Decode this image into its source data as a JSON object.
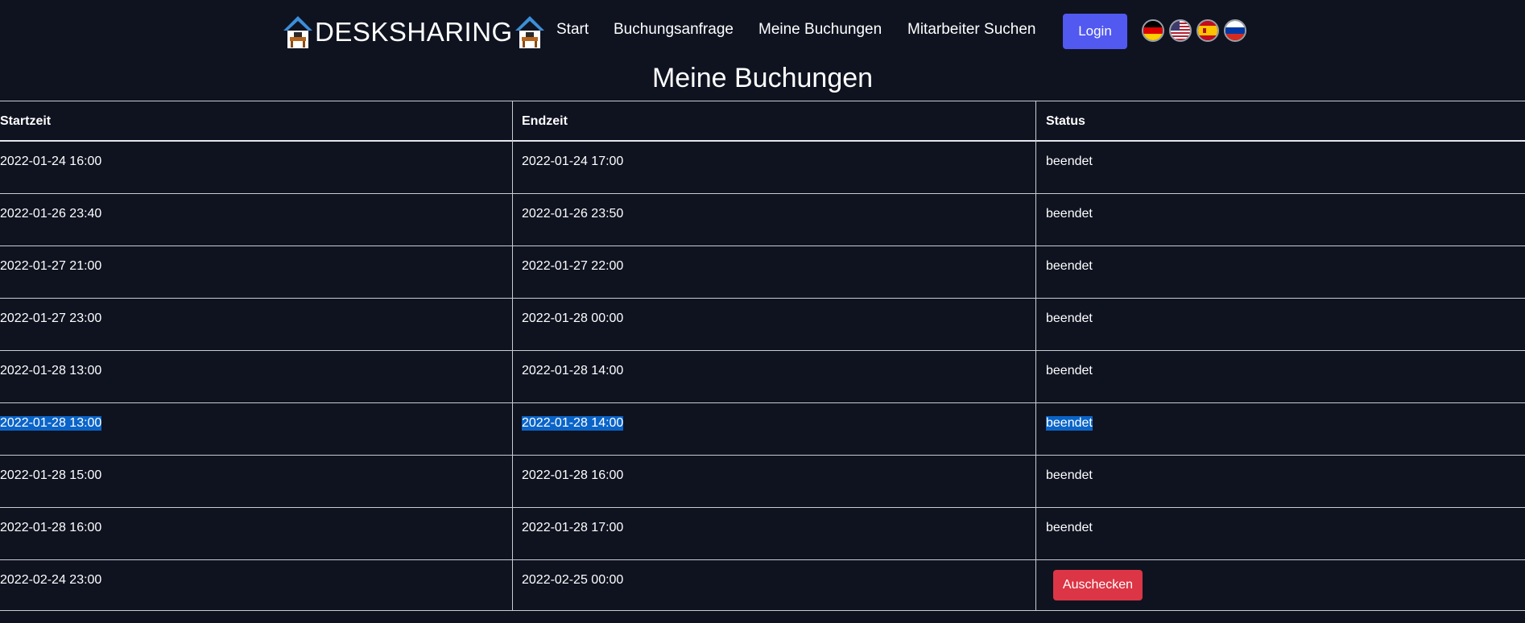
{
  "brand": {
    "name": "DESKSHARING"
  },
  "nav": {
    "items": [
      {
        "label": "Start"
      },
      {
        "label": "Buchungsanfrage"
      },
      {
        "label": "Meine Buchungen"
      },
      {
        "label": "Mitarbeiter Suchen"
      }
    ],
    "login_label": "Login",
    "languages": [
      "german-flag-icon",
      "us-flag-icon",
      "spain-flag-icon",
      "russia-flag-icon"
    ]
  },
  "page": {
    "title": "Meine Buchungen"
  },
  "table": {
    "headers": [
      "Startzeit",
      "Endzeit",
      "Status"
    ],
    "rows": [
      {
        "start": "2022-01-24 16:00",
        "end": "2022-01-24 17:00",
        "status": "beendet"
      },
      {
        "start": "2022-01-26 23:40",
        "end": "2022-01-26 23:50",
        "status": "beendet"
      },
      {
        "start": "2022-01-27 21:00",
        "end": "2022-01-27 22:00",
        "status": "beendet"
      },
      {
        "start": "2022-01-27 23:00",
        "end": "2022-01-28 00:00",
        "status": "beendet"
      },
      {
        "start": "2022-01-28 13:00",
        "end": "2022-01-28 14:00",
        "status": "beendet"
      },
      {
        "start": "2022-01-28 13:00",
        "end": "2022-01-28 14:00",
        "status": "beendet"
      },
      {
        "start": "2022-01-28 15:00",
        "end": "2022-01-28 16:00",
        "status": "beendet"
      },
      {
        "start": "2022-01-28 16:00",
        "end": "2022-01-28 17:00",
        "status": "beendet"
      },
      {
        "start": "2022-02-24 23:00",
        "end": "2022-02-25 00:00",
        "status": ""
      }
    ],
    "checkout_label": "Auschecken"
  },
  "colors": {
    "background": "#0f1320",
    "login_button": "#5159f0",
    "checkout_button": "#dc3545",
    "selection": "#0a64c8"
  }
}
